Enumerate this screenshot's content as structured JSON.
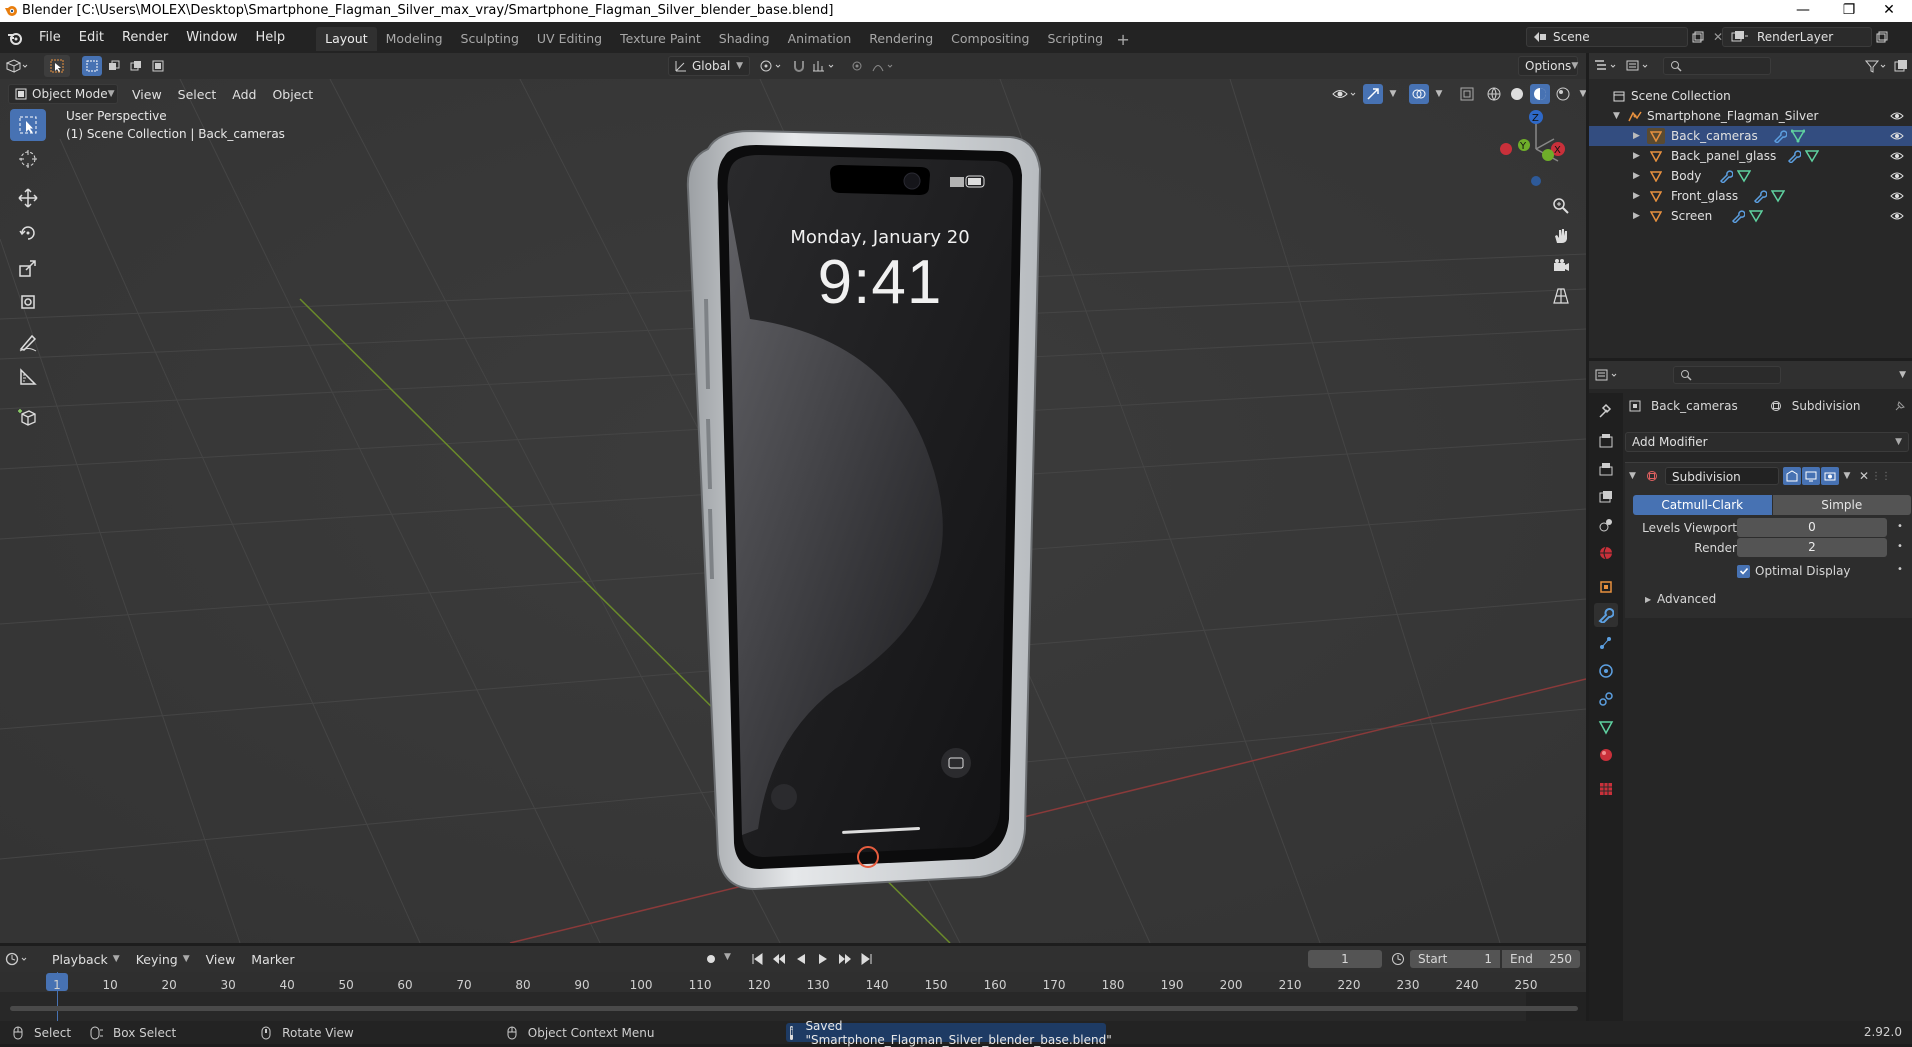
{
  "window": {
    "title": "Blender [C:\\Users\\MOLEX\\Desktop\\Smartphone_Flagman_Silver_max_vray/Smartphone_Flagman_Silver_blender_base.blend]",
    "controls": {
      "minimize": "—",
      "restore": "❐",
      "close": "✕"
    }
  },
  "menu": [
    "File",
    "Edit",
    "Render",
    "Window",
    "Help"
  ],
  "workspaces": [
    "Layout",
    "Modeling",
    "Sculpting",
    "UV Editing",
    "Texture Paint",
    "Shading",
    "Animation",
    "Rendering",
    "Compositing",
    "Scripting"
  ],
  "active_workspace": "Layout",
  "scene": {
    "name": "Scene",
    "render_layer": "RenderLayer"
  },
  "tool_header": {
    "orientation": "Global",
    "options": "Options"
  },
  "viewport": {
    "mode": "Object Mode",
    "menus": [
      "View",
      "Select",
      "Add",
      "Object"
    ],
    "info_line1": "User Perspective",
    "info_line2": "(1) Scene Collection | Back_cameras",
    "gizmo": {
      "z": "Z",
      "y": "Y",
      "x": "X"
    }
  },
  "phone_screen": {
    "date": "Monday, January 20",
    "time": "9:41"
  },
  "outliner": {
    "root": "Scene Collection",
    "collection": "Smartphone_Flagman_Silver",
    "objects": [
      "Back_cameras",
      "Back_panel_glass",
      "Body",
      "Front_glass",
      "Screen"
    ]
  },
  "properties": {
    "object": "Back_cameras",
    "modifier_tab": "Subdivision",
    "add_modifier": "Add Modifier",
    "modifier_name": "Subdivision",
    "method_options": [
      "Catmull-Clark",
      "Simple"
    ],
    "active_method": "Catmull-Clark",
    "levels_viewport_label": "Levels Viewport",
    "levels_viewport": "0",
    "render_label": "Render",
    "render": "2",
    "optimal_display_label": "Optimal Display",
    "optimal_display": true,
    "advanced": "Advanced"
  },
  "timeline": {
    "menus": [
      "Playback",
      "Keying",
      "View",
      "Marker"
    ],
    "current_frame": "1",
    "start_label": "Start",
    "start": "1",
    "end_label": "End",
    "end": "250",
    "ticks": [
      "1",
      "10",
      "20",
      "30",
      "40",
      "50",
      "60",
      "70",
      "80",
      "90",
      "100",
      "110",
      "120",
      "130",
      "140",
      "150",
      "160",
      "170",
      "180",
      "190",
      "200",
      "210",
      "220",
      "230",
      "240",
      "250"
    ]
  },
  "statusbar": {
    "select": "Select",
    "box_select": "Box Select",
    "rotate_view": "Rotate View",
    "context_menu": "Object Context Menu",
    "message": "Saved \"Smartphone_Flagman_Silver_blender_base.blend\"",
    "version": "2.92.0"
  },
  "colors": {
    "accent": "#4772b3",
    "object_orange": "#e8913f",
    "modifier_blue": "#5c9fe0",
    "mesh_green": "#5fd1a0"
  }
}
